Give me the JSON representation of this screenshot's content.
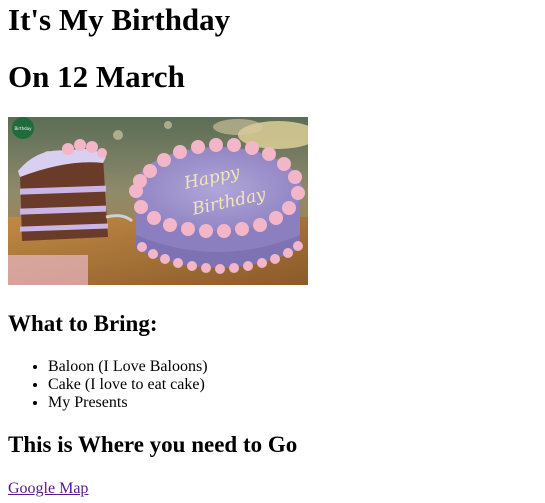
{
  "headings": {
    "title": "It's My Birthday",
    "date": "On 12 March",
    "bring": "What to Bring:",
    "where": "This is Where you need to Go"
  },
  "image": {
    "alt": "Birthday cake",
    "cake_text_line1": "Happy",
    "cake_text_line2": "Birthday",
    "logo_text": "Birthday",
    "colors": {
      "frosting": "#9b8fc8",
      "frosting_dark": "#7f72b3",
      "pink": "#f2b6c8",
      "chocolate": "#6b3b2a",
      "table": "#b07a3c",
      "logo": "#1f6b3a"
    }
  },
  "bring_list": [
    "Baloon (I Love Baloons)",
    "Cake (I love to eat cake)",
    "My Presents"
  ],
  "link": {
    "label": "Google Map"
  }
}
